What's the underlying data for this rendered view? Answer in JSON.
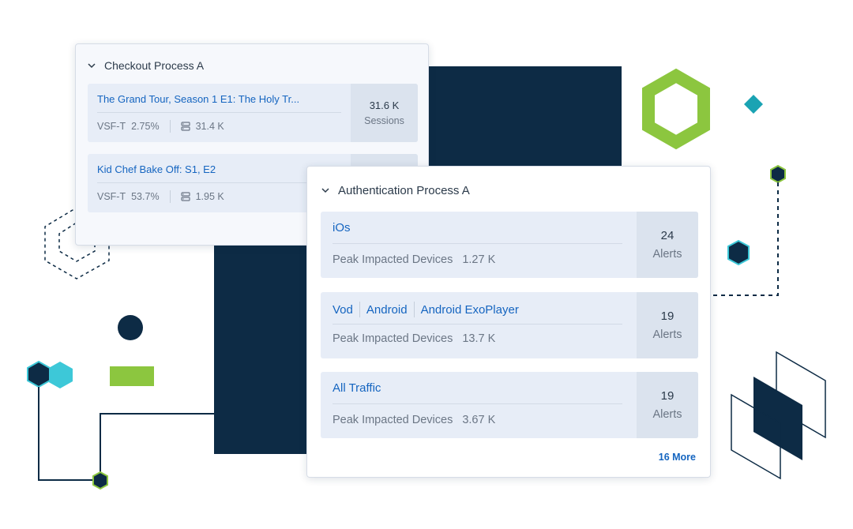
{
  "colors": {
    "navy": "#0d2b45",
    "lime": "#8cc63f",
    "teal": "#1aa3b3",
    "cyan": "#3dc8d8",
    "link": "#1565c0",
    "card_bg": "#e7edf7"
  },
  "checkout": {
    "title": "Checkout Process A",
    "cards": [
      {
        "title": "The Grand Tour, Season 1 E1: The Holy Tr...",
        "metric_name": "VSF-T",
        "metric_value": "2.75%",
        "db_value": "31.4 K",
        "side_value": "31.6 K",
        "side_label": "Sessions"
      },
      {
        "title": "Kid Chef Bake Off: S1, E2",
        "metric_name": "VSF-T",
        "metric_value": "53.7%",
        "db_value": "1.95 K"
      }
    ]
  },
  "auth": {
    "title": "Authentication Process A",
    "cards": [
      {
        "tags": [
          "iOs"
        ],
        "meta_label": "Peak Impacted Devices",
        "meta_value": "1.27 K",
        "side_value": "24",
        "side_label": "Alerts"
      },
      {
        "tags": [
          "Vod",
          "Android",
          "Android ExoPlayer"
        ],
        "meta_label": "Peak Impacted Devices",
        "meta_value": "13.7 K",
        "side_value": "19",
        "side_label": "Alerts"
      },
      {
        "tags": [
          "All Traffic"
        ],
        "meta_label": "Peak Impacted Devices",
        "meta_value": "3.67 K",
        "side_value": "19",
        "side_label": "Alerts"
      }
    ],
    "more_label": "16 More"
  },
  "icons": {
    "collapse": "chevron-down-icon",
    "storage": "database-icon"
  }
}
